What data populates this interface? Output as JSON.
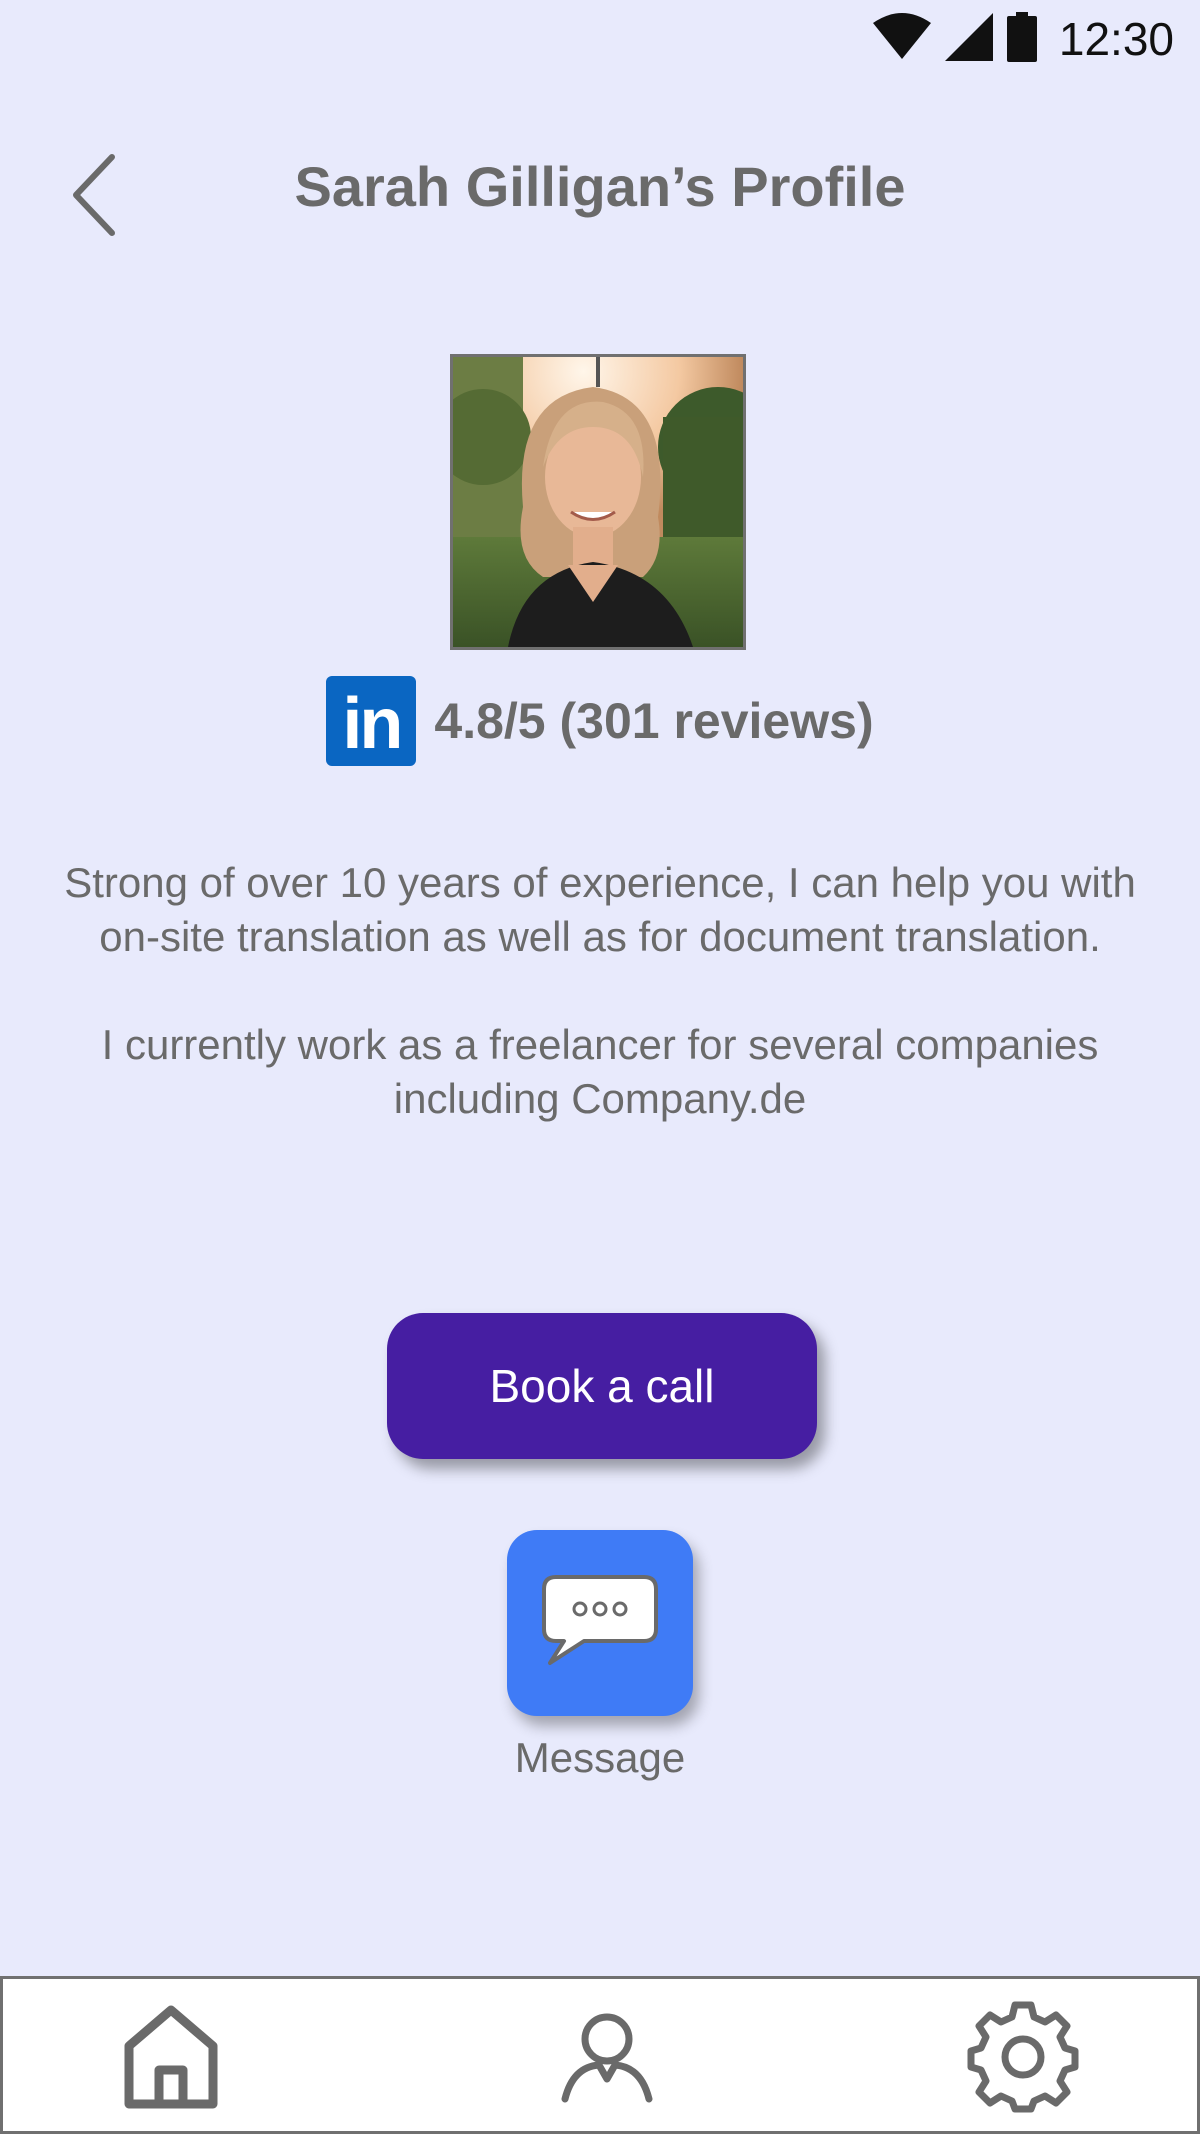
{
  "status_bar": {
    "time": "12:30",
    "icons": [
      "wifi-icon",
      "cellular-signal-icon",
      "battery-icon"
    ]
  },
  "header": {
    "title": "Sarah Gilligan’s Profile",
    "back_icon": "chevron-left-icon"
  },
  "profile": {
    "photo_alt": "Sarah Gilligan",
    "linkedin_label": "in",
    "rating": "4.8/5 (301 reviews)",
    "bio": [
      "Strong of over 10 years of experience, I can help you with on-site translation as well as for document translation.",
      "I currently work as a freelancer for several companies including Company.de"
    ]
  },
  "actions": {
    "book_label": "Book a call",
    "message_label": "Message",
    "message_icon": "chat-bubble-icon"
  },
  "bottom_nav": {
    "items": [
      {
        "icon": "home-icon"
      },
      {
        "icon": "profile-icon"
      },
      {
        "icon": "settings-gear-icon"
      }
    ]
  },
  "colors": {
    "background": "#e8eafc",
    "text": "#6a6a6a",
    "primary_button": "#461ea2",
    "message_button": "#3f7bf6",
    "linkedin": "#0a66c2"
  }
}
